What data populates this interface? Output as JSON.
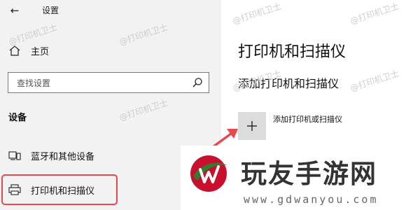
{
  "header": {
    "back_icon": "arrow-left-icon",
    "title": "设置"
  },
  "nav": {
    "home": {
      "icon": "home-icon",
      "label": "主页"
    },
    "bluetooth": {
      "icon": "bluetooth-devices-icon",
      "label": "蓝牙和其他设备"
    },
    "printers": {
      "icon": "printer-icon",
      "label": "打印机和扫描仪",
      "highlighted": true
    }
  },
  "search": {
    "placeholder": "查找设置",
    "icon": "search-icon"
  },
  "section": {
    "heading": "设备"
  },
  "main": {
    "title": "打印机和扫描仪",
    "subtitle": "添加打印机和扫描仪",
    "add_button": {
      "icon": "plus-icon",
      "label": "添加打印机或扫描仪"
    }
  },
  "annotation": {
    "highlight_color": "#e8484b",
    "arrow_icon": "red-arrow-icon"
  },
  "watermark": {
    "text": "@打印机卫士"
  },
  "banner": {
    "logo": "wanyou-logo",
    "brand": "玩友手游网",
    "url": "www.gdwanyou.com",
    "accent_color": "#c8102e"
  }
}
